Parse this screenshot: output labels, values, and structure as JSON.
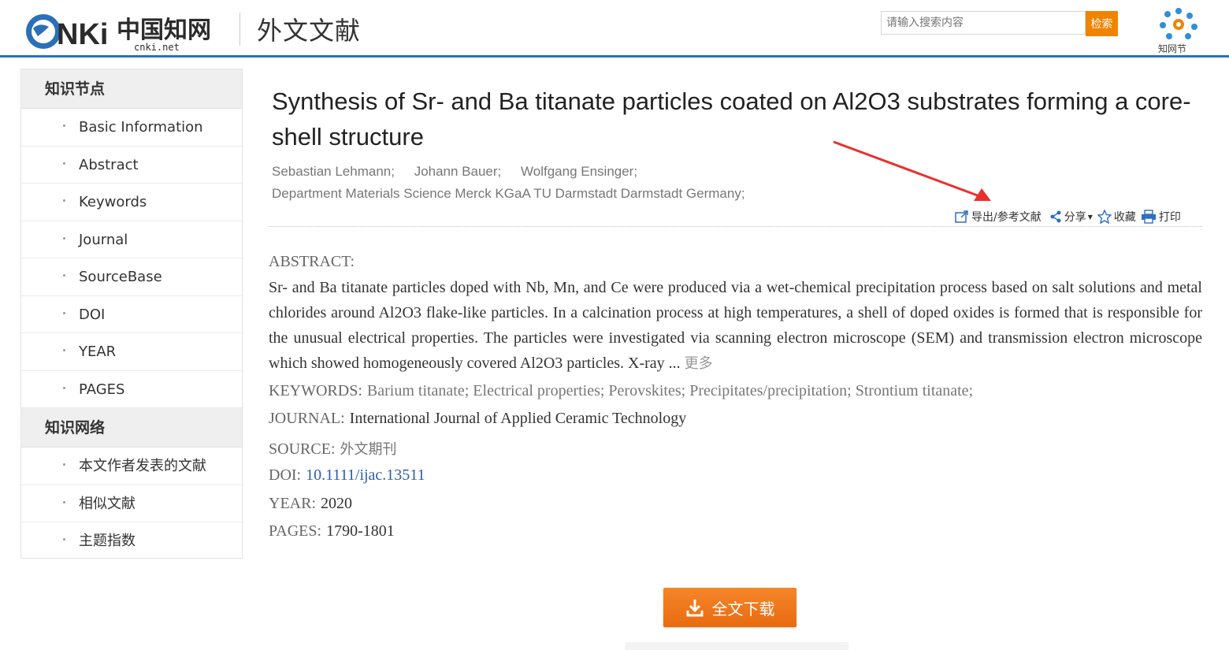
{
  "header": {
    "logo_text": "CNKi中国知网",
    "logo_sub": "cnki.net",
    "site_title": "外文文献",
    "search_placeholder": "请输入搜索内容",
    "search_button": "检索",
    "zhiwangjie_label": "知网节"
  },
  "sidebar": {
    "section1_title": "知识节点",
    "section1_items": [
      "Basic Information",
      "Abstract",
      "Keywords",
      "Journal",
      "SourceBase",
      "DOI",
      "YEAR",
      "PAGES"
    ],
    "section2_title": "知识网络",
    "section2_items": [
      "本文作者发表的文献",
      "相似文献",
      "主题指数"
    ]
  },
  "article": {
    "title": "Synthesis of Sr- and Ba titanate particles coated on Al2O3 substrates forming a core-shell structure",
    "authors": [
      "Sebastian Lehmann;",
      "Johann Bauer;",
      "Wolfgang Ensinger;"
    ],
    "affiliation": "Department Materials Science Merck KGaA TU Darmstadt Darmstadt Germany;",
    "abstract_label": "ABSTRACT:",
    "abstract_text": "Sr- and Ba titanate particles doped with Nb, Mn, and Ce were produced via a wet-chemical precipitation process based on salt solutions and metal chlorides around Al2O3 flake-like particles. In a calcination process at high temperatures, a shell of doped oxides is formed that is responsible for the unusual electrical properties. The particles were investigated via scanning electron microscope (SEM) and transmission electron microscope which showed homogeneously covered Al2O3 particles. X-ray ...",
    "abstract_more": "更多",
    "keywords_label": "KEYWORDS:",
    "keywords": "Barium titanate; Electrical properties; Perovskites; Precipitates/precipitation; Strontium titanate;",
    "journal_label": "JOURNAL:",
    "journal": "International Journal of Applied Ceramic Technology",
    "source_label": "SOURCE:",
    "source": "外文期刊",
    "doi_label": "DOI:",
    "doi": "10.1111/ijac.13511",
    "year_label": "YEAR:",
    "year": "2020",
    "pages_label": "PAGES:",
    "pages": "1790-1801"
  },
  "toolbar": {
    "export": "导出/参考文献",
    "share": "分享",
    "favorite": "收藏",
    "print": "打印"
  },
  "download_button": "全文下载",
  "colors": {
    "accent_blue": "#2f6fc0",
    "orange": "#f08300",
    "arrow_red": "#e8312f",
    "link_blue": "#2a5da8"
  }
}
